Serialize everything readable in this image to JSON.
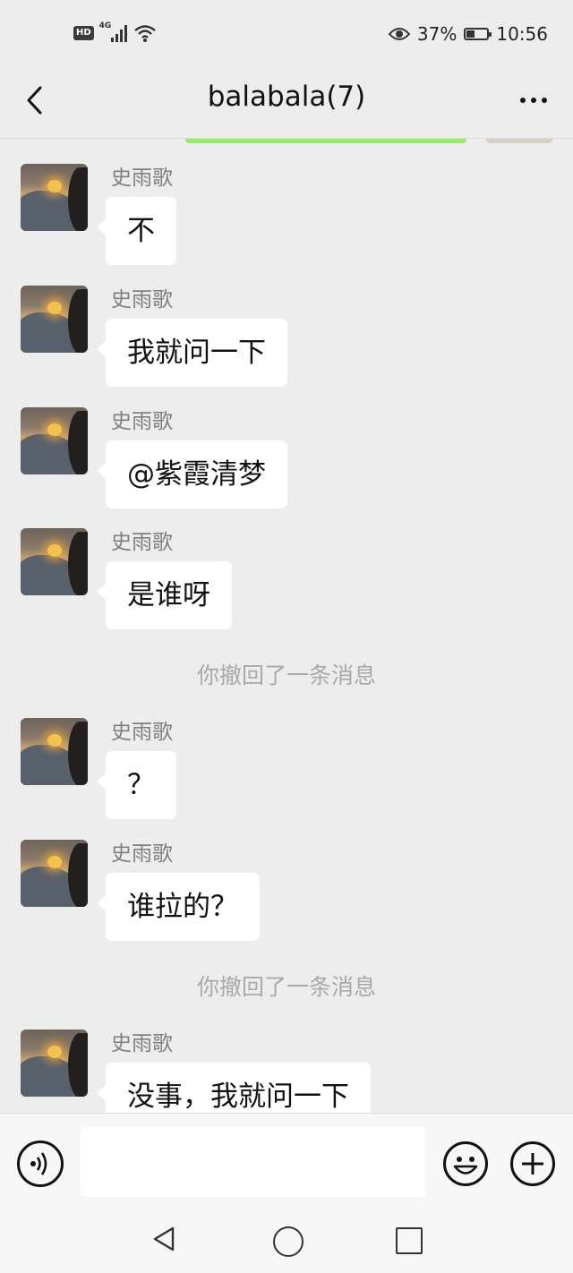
{
  "status_bar": {
    "hd": "HD",
    "network": "4G",
    "battery_percent": "37%",
    "battery_level": 0.37,
    "time": "10:56",
    "icons": [
      "eye-icon",
      "signal-icon",
      "wifi-icon",
      "battery-icon"
    ]
  },
  "header": {
    "title": "balabala(7)",
    "icons": [
      "back-arrow-icon",
      "more-icon"
    ]
  },
  "messages": [
    {
      "sender": "史雨歌",
      "text": "不"
    },
    {
      "sender": "史雨歌",
      "text": "我就问一下"
    },
    {
      "sender": "史雨歌",
      "text": "@紫霞清梦"
    },
    {
      "sender": "史雨歌",
      "text": "是谁呀"
    },
    {
      "system": "你撤回了一条消息"
    },
    {
      "sender": "史雨歌",
      "text": "？"
    },
    {
      "sender": "史雨歌",
      "text": "谁拉的？"
    },
    {
      "system": "你撤回了一条消息"
    },
    {
      "sender": "史雨歌",
      "text": "没事，我就问一下"
    }
  ],
  "input_bar": {
    "text_value": "",
    "icons": [
      "voice-icon",
      "emoji-icon",
      "plus-icon"
    ]
  },
  "nav_bar": {
    "icons": [
      "nav-back-icon",
      "nav-home-icon",
      "nav-recent-icon"
    ]
  },
  "colors": {
    "background": "#ededed",
    "bubble": "#ffffff",
    "own_bubble": "#95ec69",
    "sender_text": "#7f7f7f",
    "system_text": "#a9a9a9"
  }
}
